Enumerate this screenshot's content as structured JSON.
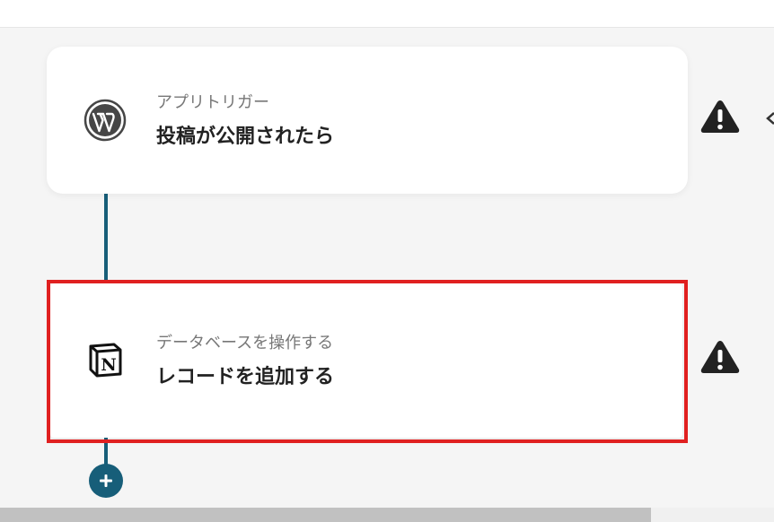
{
  "colors": {
    "connector": "#175e79",
    "highlight": "#e02020",
    "warning": "#222222"
  },
  "flow": {
    "steps": [
      {
        "icon": "wordpress-icon",
        "subtitle": "アプリトリガー",
        "title": "投稿が公開されたら"
      },
      {
        "icon": "notion-icon",
        "subtitle": "データベースを操作する",
        "title": "レコードを追加する"
      }
    ]
  },
  "warning_icon": "warning-icon",
  "add_button_icon": "plus-icon",
  "scrollbar": {
    "horizontal_visible_fraction": 0.84
  }
}
